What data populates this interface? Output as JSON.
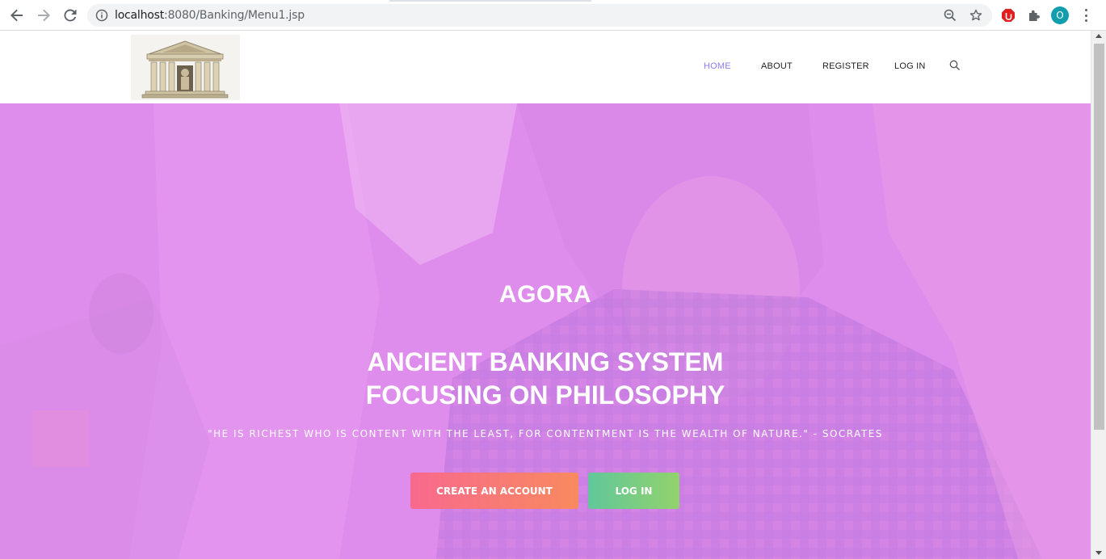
{
  "browser": {
    "url_host": "localhost",
    "url_path": ":8080/Banking/Menu1.jsp",
    "avatar_letter": "O",
    "icons": [
      "back-icon",
      "forward-icon",
      "reload-icon",
      "info-icon",
      "zoom-icon",
      "bookmark-star-icon",
      "adblock-extension-icon",
      "extensions-puzzle-icon",
      "profile-avatar",
      "more-menu-icon"
    ]
  },
  "header": {
    "logo": "temple-logo",
    "nav": {
      "home": "HOME",
      "about": "ABOUT",
      "register": "REGISTER",
      "login": "LOG IN"
    },
    "active_color": "#8a7df2"
  },
  "hero": {
    "brand": "AGORA",
    "title_line1": "ANCIENT BANKING SYSTEM",
    "title_line2": "FOCUSING ON PHILOSOPHY",
    "quote": "\"HE IS RICHEST WHO IS CONTENT WITH THE LEAST, FOR CONTENTMENT IS THE WEALTH OF NATURE.\" - SOCRATES",
    "create_button": "CREATE AN ACCOUNT",
    "login_button": "LOG IN",
    "overlay_color": "#de8cee"
  }
}
